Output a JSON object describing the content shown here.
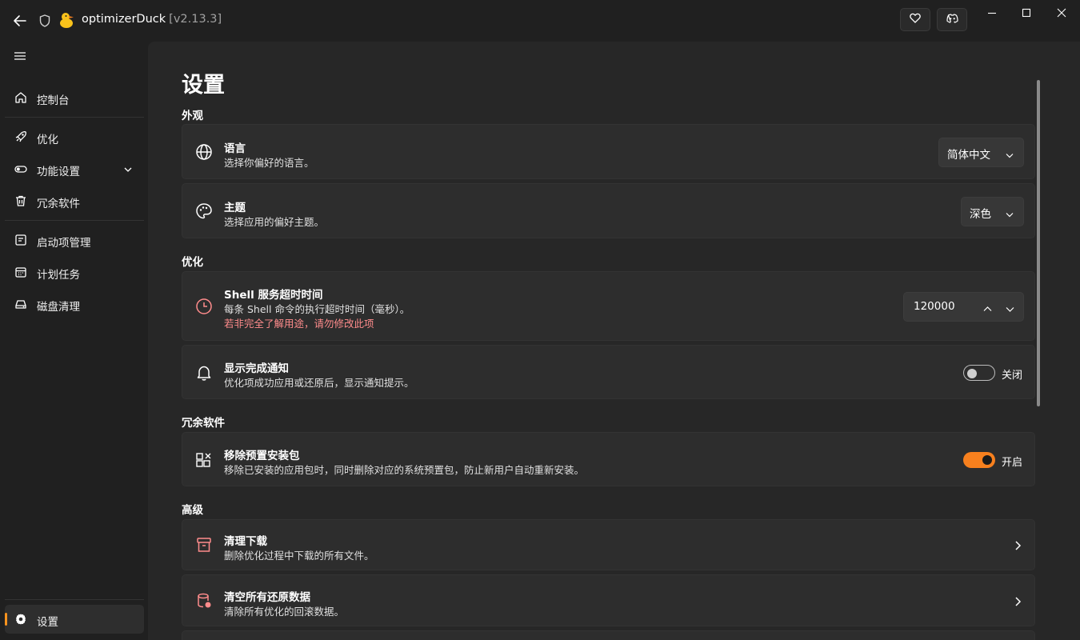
{
  "app": {
    "name": "optimizerDuck",
    "version": "[v2.13.3]"
  },
  "sidebar": {
    "items": [
      {
        "label": "控制台"
      },
      {
        "label": "优化"
      },
      {
        "label": "功能设置"
      },
      {
        "label": "冗余软件"
      },
      {
        "label": "启动项管理"
      },
      {
        "label": "计划任务"
      },
      {
        "label": "磁盘清理"
      }
    ],
    "settings_label": "设置"
  },
  "page": {
    "title": "设置",
    "sections": {
      "appearance": "外观",
      "optimize": "优化",
      "bloat": "冗余软件",
      "advanced": "高级"
    },
    "language": {
      "title": "语言",
      "desc": "选择你偏好的语言。",
      "value": "简体中文"
    },
    "theme": {
      "title": "主题",
      "desc": "选择应用的偏好主题。",
      "value": "深色"
    },
    "shell_timeout": {
      "title": "Shell 服务超时时间",
      "desc": "每条 Shell 命令的执行超时时间（毫秒）。",
      "warning": "若非完全了解用途，请勿修改此项",
      "value": "120000"
    },
    "notify": {
      "title": "显示完成通知",
      "desc": "优化项成功应用或还原后，显示通知提示。",
      "state_label": "关闭",
      "enabled": false
    },
    "remove_preinstalled": {
      "title": "移除预置安装包",
      "desc": "移除已安装的应用包时，同时删除对应的系统预置包，防止新用户自动重新安装。",
      "state_label": "开启",
      "enabled": true
    },
    "clean_downloads": {
      "title": "清理下载",
      "desc": "删除优化过程中下载的所有文件。"
    },
    "clear_restore": {
      "title": "清空所有还原数据",
      "desc": "清除所有优化的回滚数据。"
    }
  },
  "colors": {
    "accent": "#f7801e",
    "warning": "#ff8c8c",
    "background": "#202020",
    "card": "#2d2d2d"
  }
}
